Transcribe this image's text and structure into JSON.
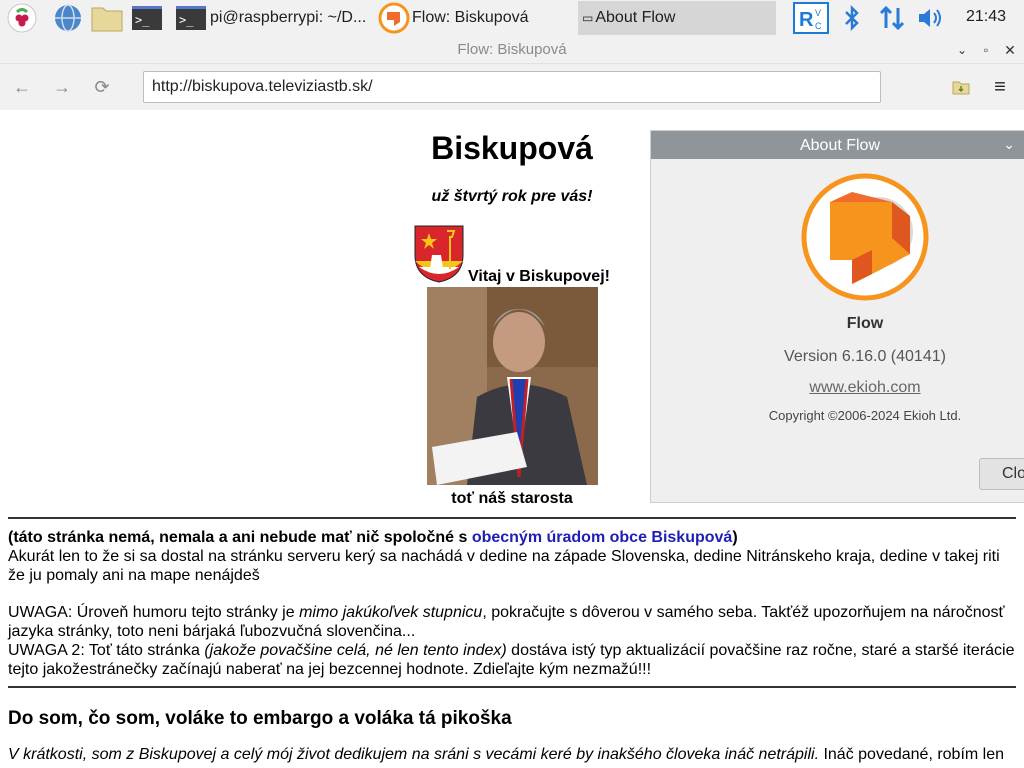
{
  "taskbar": {
    "task1": "pi@raspberrypi: ~/D...",
    "task2": "Flow: Biskupová",
    "task3": "About Flow",
    "clock": "21:43"
  },
  "window": {
    "title": "Flow: Biskupová"
  },
  "browser": {
    "url": "http://biskupova.televiziastb.sk/"
  },
  "page": {
    "title": "Biskupová",
    "subtitle": "už štvrtý rok pre vás!",
    "welcome": "Vitaj v Biskupovej!",
    "caption": "toť náš starosta",
    "notice_start": "(táto stránka nemá, nemala a ani nebude mať nič spoločné s ",
    "notice_link": "obecným úradom obce Biskupová",
    "notice_end": ")",
    "notice_body": "Akurát len to že si sa dostal na stránku serveru kerý sa nachádá v dedine na západe Slovenska, dedine Nitránskeho kraja, dedine v takej riti že ju pomaly ani na mape nenájdeš",
    "warn1_start": "UWAGA: Úroveň humoru tejto stránky je ",
    "warn1_italic": "mimo jakúkoľvek stupnicu",
    "warn1_end": ", pokračujte s dôverou v samého seba. Takťéž upozorňujem na náročnosť jazyka stránky, toto neni bárjaká ľubozvučná slovenčina...",
    "warn2_start": "UWAGA 2: Toť táto stránka ",
    "warn2_italic": "(jakože povačšine celá, né len tento index)",
    "warn2_end": " dostáva istý typ aktualizácií povačšine raz ročne, staré a staršé iterácie tejto jakožestránečky začínajú naberať na jej bezcennej hodnote. Zdieľajte kým nezmažú!!!",
    "heading": "Do som, čo som, voláke to embargo a voláka tá pikoška",
    "intro_italic": "V krátkosti, som z Biskupovej a celý mój život dedikujem na sráni s vecámi keré by inakšého človeka ináč netrápili.",
    "intro_end": " Ináč povedané, robím len"
  },
  "about": {
    "header": "About Flow",
    "name": "Flow",
    "version": "Version 6.16.0 (40141)",
    "site": "www.ekioh.com",
    "copyright": "Copyright ©2006-2024 Ekioh Ltd.",
    "close": "Clo"
  },
  "colors": {
    "link": "#1f1fb5",
    "flow_orange": "#f7941d",
    "dialog_header": "#8f9599"
  }
}
